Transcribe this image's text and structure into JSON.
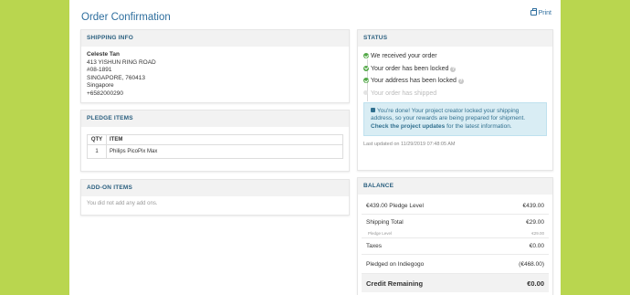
{
  "header": {
    "title": "Order Confirmation",
    "print_label": "Print"
  },
  "shipping": {
    "heading": "SHIPPING INFO",
    "name": "Celeste Tan",
    "address_lines": [
      "413 YISHUN RING ROAD",
      "#08-1891",
      "SINGAPORE, 760413",
      "Singapore",
      "+6582000290"
    ]
  },
  "pledge": {
    "heading": "PLEDGE ITEMS",
    "col_qty": "QTY",
    "col_item": "ITEM",
    "rows": [
      {
        "qty": "1",
        "item": "Philips PicoPix Max"
      }
    ]
  },
  "addons": {
    "heading": "ADD-ON ITEMS",
    "empty_text": "You did not add any add ons."
  },
  "status": {
    "heading": "STATUS",
    "steps": [
      {
        "label": "We received your order",
        "done": true,
        "help": false
      },
      {
        "label": "Your order has been locked",
        "done": true,
        "help": true
      },
      {
        "label": "Your address has been locked",
        "done": true,
        "help": true
      },
      {
        "label": "Your order has shipped",
        "done": false,
        "help": false
      }
    ],
    "alert_text": "You're done! Your project creator locked your shipping address, so your rewards are being prepared for shipment.",
    "alert_link": "Check the project updates",
    "alert_suffix": "for the latest information.",
    "last_updated": "Last updated on 11/29/2019 07:48:05 AM"
  },
  "balance": {
    "heading": "BALANCE",
    "pledge_level_label": "€439.00 Pledge Level",
    "pledge_level_value": "€439.00",
    "shipping_total_label": "Shipping Total",
    "shipping_total_value": "€29.00",
    "shipping_sub_label": "Pledge Level",
    "shipping_sub_value": "€29.00",
    "taxes_label": "Taxes",
    "taxes_value": "€0.00",
    "pledged_label": "Pledged on Indiegogo",
    "pledged_value": "(€468.00)",
    "credit_label": "Credit Remaining",
    "credit_value": "€0.00"
  },
  "colors": {
    "background": "#b9d64f",
    "accent": "#2e6e9e",
    "success": "#52a847",
    "alert_bg": "#d9edf4"
  }
}
